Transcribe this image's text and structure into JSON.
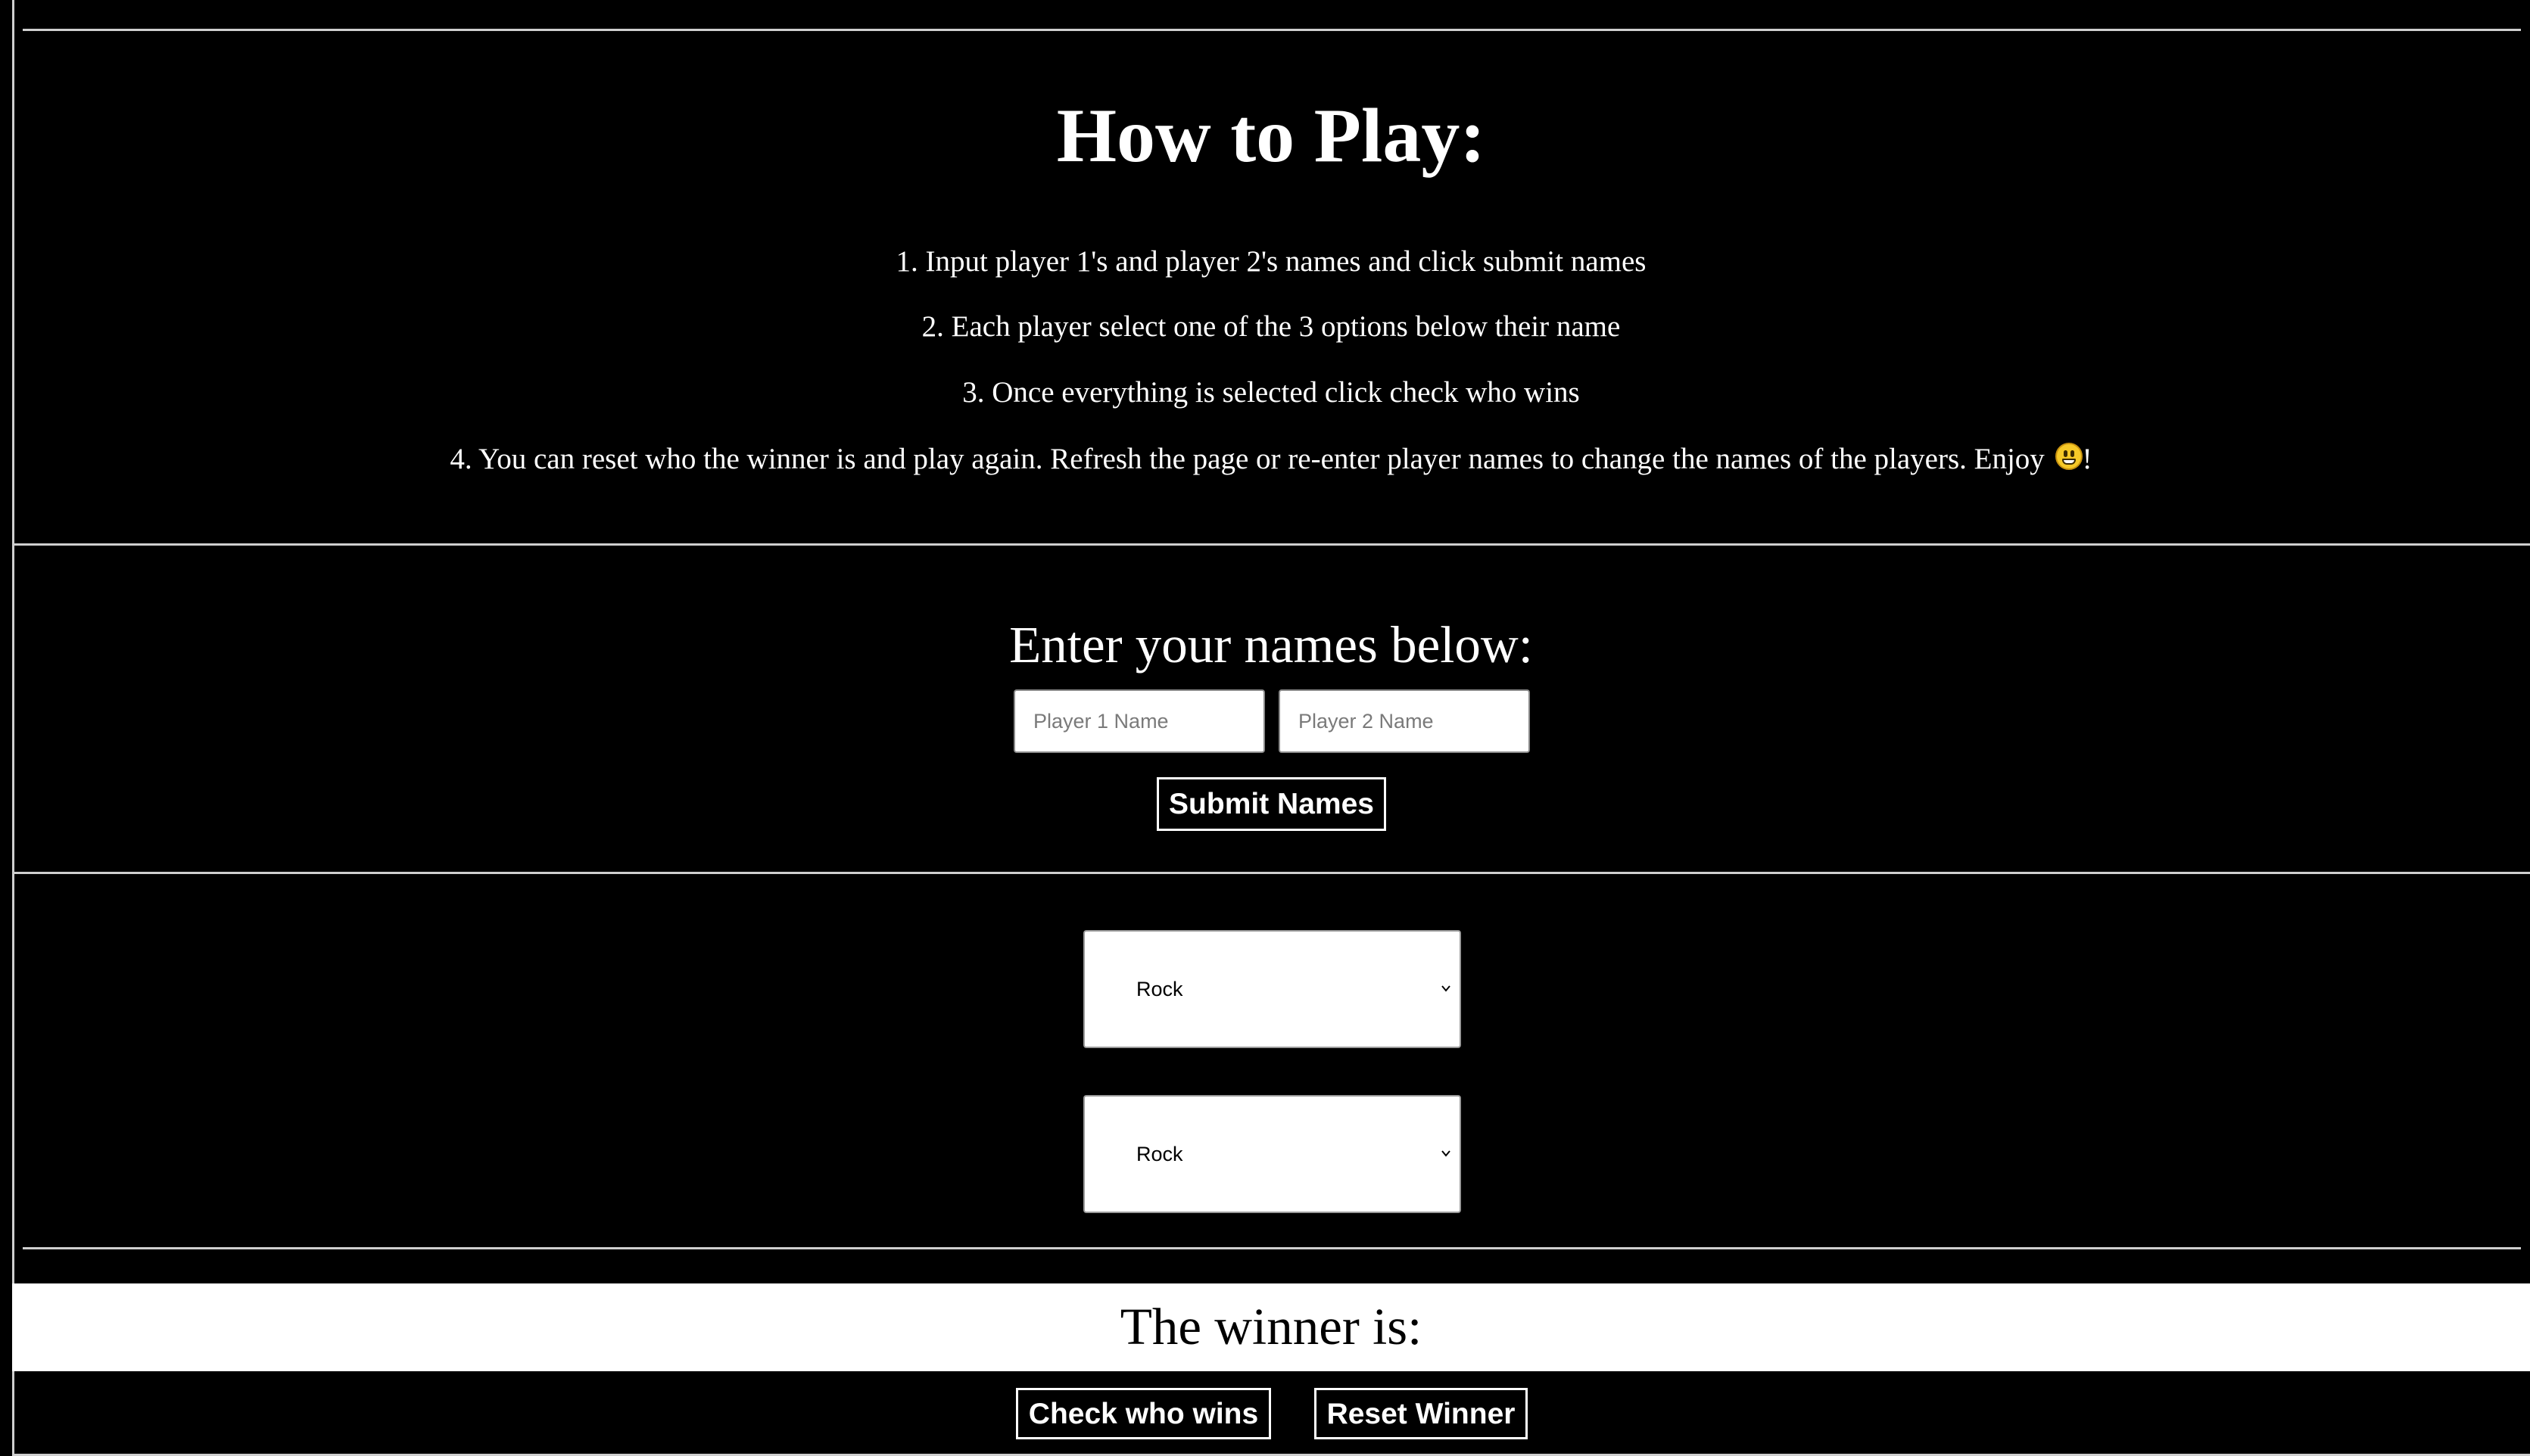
{
  "how_to_play": {
    "title": "How to Play:",
    "steps": [
      "1. Input player 1's and player 2's names and click submit names",
      "2. Each player select one of the 3 options below their name",
      "3. Once everything is selected click check who wins",
      "4. You can reset who the winner is and play again. Refresh the page or re-enter player names to change the names of the players. Enjoy"
    ],
    "step4_suffix": "!",
    "emoji_icon": "grinning-face-icon"
  },
  "names_section": {
    "title": "Enter your names below:",
    "player1_placeholder": "Player 1 Name",
    "player1_value": "",
    "player2_placeholder": "Player 2 Name",
    "player2_value": "",
    "submit_label": "Submit Names"
  },
  "choices": {
    "player1_selected": "Rock",
    "player2_selected": "Rock",
    "chevron_icon": "chevron-down-icon"
  },
  "winner": {
    "label": "The winner is:"
  },
  "actions": {
    "check_label": "Check who wins",
    "reset_label": "Reset Winner"
  },
  "colors": {
    "background": "#000000",
    "foreground": "#ffffff",
    "divider": "#cfcfcf"
  }
}
